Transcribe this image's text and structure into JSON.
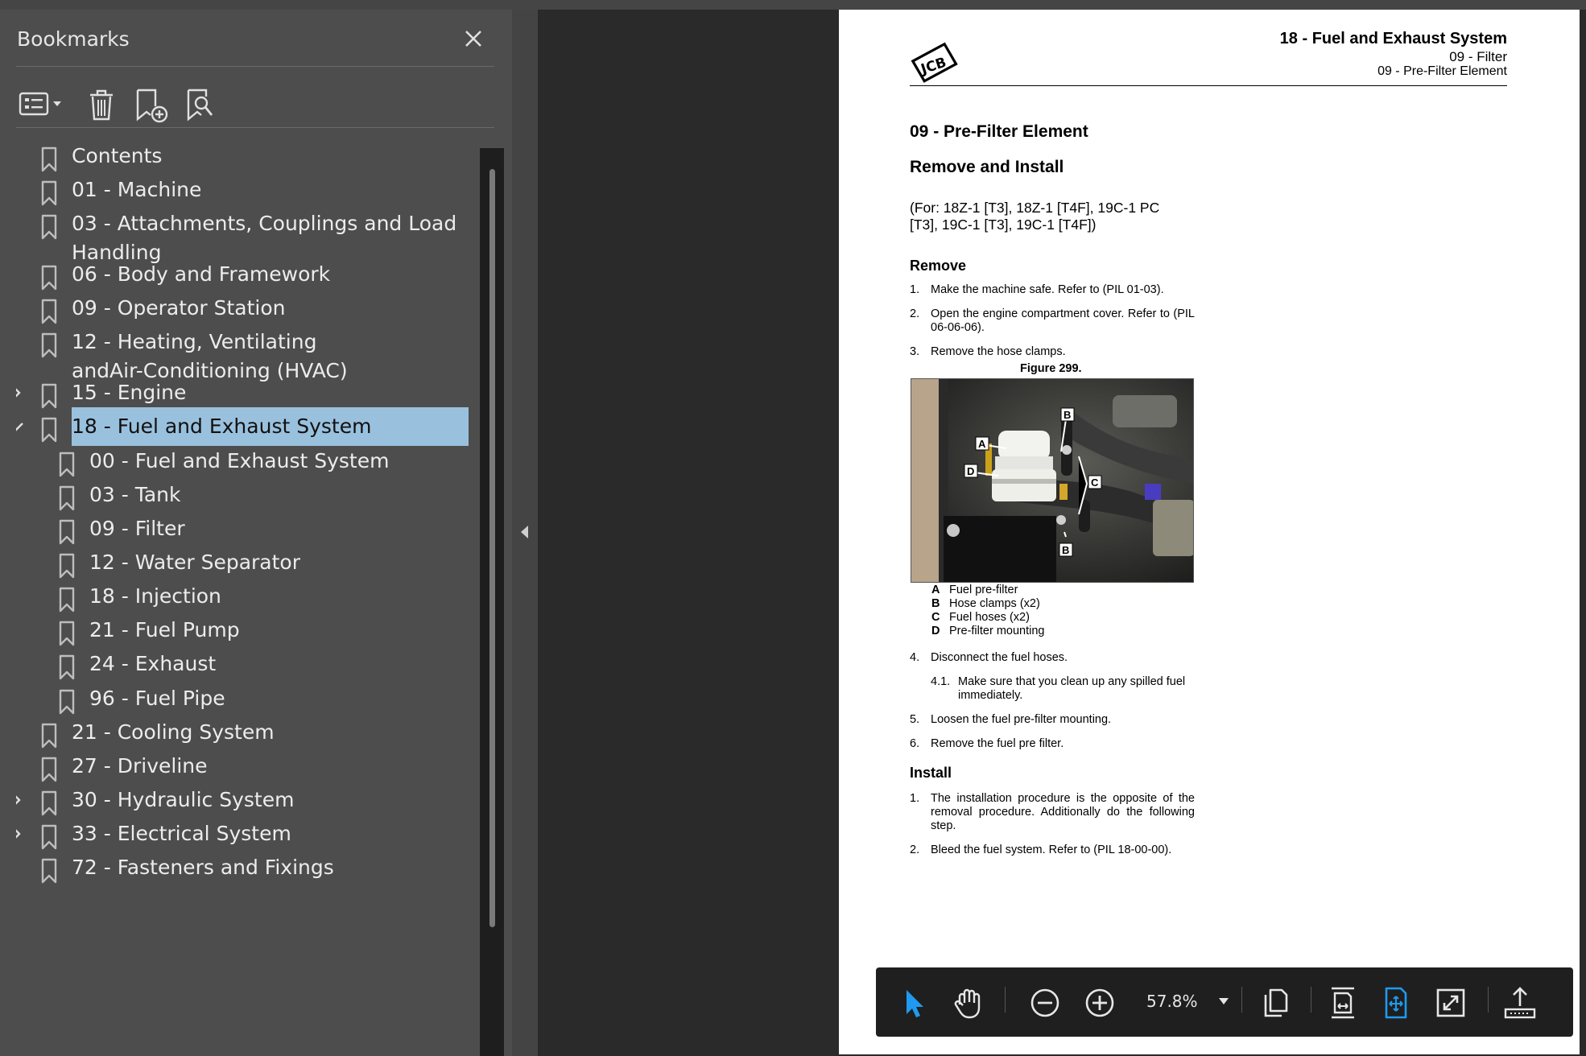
{
  "bookmarks_panel": {
    "title": "Bookmarks",
    "close_icon": "close-icon",
    "toolbar": [
      {
        "name": "bookmark-options-button",
        "icon": "list-options-icon"
      },
      {
        "name": "delete-bookmark-button",
        "icon": "trash-icon"
      },
      {
        "name": "add-bookmark-button",
        "icon": "bookmark-add-icon"
      },
      {
        "name": "find-bookmark-button",
        "icon": "bookmark-search-icon"
      }
    ],
    "items": [
      {
        "label": "Contents",
        "level": 0,
        "expander": "none"
      },
      {
        "label": "01 - Machine",
        "level": 0,
        "expander": "none"
      },
      {
        "label_line1": "03 - Attachments, Couplings and Load",
        "label_line2": "Handling",
        "level": 0,
        "expander": "none"
      },
      {
        "label": "06 - Body and Framework",
        "level": 0,
        "expander": "none"
      },
      {
        "label": "09 - Operator Station",
        "level": 0,
        "expander": "none"
      },
      {
        "label_line1": "12 - Heating, Ventilating",
        "label_line2": "andAir-Conditioning (HVAC)",
        "level": 0,
        "expander": "none"
      },
      {
        "label": "15 - Engine",
        "level": 0,
        "expander": "collapsed"
      },
      {
        "label": "18 - Fuel and Exhaust System",
        "level": 0,
        "expander": "expanded",
        "selected": true
      },
      {
        "label": "00 - Fuel and Exhaust System",
        "level": 1,
        "expander": "none"
      },
      {
        "label": "03 - Tank",
        "level": 1,
        "expander": "none"
      },
      {
        "label": "09 - Filter",
        "level": 1,
        "expander": "none"
      },
      {
        "label": "12 - Water Separator",
        "level": 1,
        "expander": "none"
      },
      {
        "label": "18 - Injection",
        "level": 1,
        "expander": "none"
      },
      {
        "label": "21 - Fuel Pump",
        "level": 1,
        "expander": "none"
      },
      {
        "label": "24 - Exhaust",
        "level": 1,
        "expander": "none"
      },
      {
        "label": "96 - Fuel Pipe",
        "level": 1,
        "expander": "none"
      },
      {
        "label": "21 - Cooling System",
        "level": 0,
        "expander": "none"
      },
      {
        "label": "27 - Driveline",
        "level": 0,
        "expander": "none"
      },
      {
        "label": "30 - Hydraulic System",
        "level": 0,
        "expander": "collapsed"
      },
      {
        "label": "33 - Electrical System",
        "level": 0,
        "expander": "collapsed"
      },
      {
        "label": "72 - Fasteners and Fixings",
        "level": 0,
        "expander": "none"
      }
    ]
  },
  "document": {
    "header_title": "18 - Fuel and Exhaust System",
    "header_sub1": "09 - Filter",
    "header_sub2": "09 - Pre-Filter Element",
    "heading1": "09 - Pre-Filter Element",
    "heading2": "Remove and Install",
    "applies_to_line1": "(For: 18Z-1 [T3], 18Z-1 [T4F], 19C-1 PC",
    "applies_to_line2": "[T3], 19C-1 [T3], 19C-1 [T4F])",
    "remove_heading": "Remove",
    "remove_steps": [
      {
        "n": "1.",
        "text": "Make the machine safe. Refer to (PIL 01-03)."
      },
      {
        "n": "2.",
        "text": "Open the engine compartment cover. Refer to (PIL 06-06-06)."
      },
      {
        "n": "3.",
        "text": "Remove the hose clamps."
      }
    ],
    "figure_title": "Figure 299.",
    "figure_callouts": [
      "A",
      "B",
      "B",
      "C",
      "D"
    ],
    "legend": [
      {
        "key": "A",
        "text": "Fuel pre-filter"
      },
      {
        "key": "B",
        "text": "Hose clamps (x2)"
      },
      {
        "key": "C",
        "text": "Fuel hoses (x2)"
      },
      {
        "key": "D",
        "text": "Pre-filter mounting"
      }
    ],
    "remove_steps_2": [
      {
        "n": "4.",
        "text": "Disconnect the fuel hoses."
      },
      {
        "n": "4.1.",
        "text": "Make sure that you clean up any spilled fuel immediately."
      },
      {
        "n": "5.",
        "text": "Loosen the fuel pre-filter mounting."
      },
      {
        "n": "6.",
        "text": "Remove the fuel pre filter."
      }
    ],
    "install_heading": "Install",
    "install_steps": [
      {
        "n": "1.",
        "text": "The installation procedure is the opposite of the removal procedure. Additionally do the following step."
      },
      {
        "n": "2.",
        "text": "Bleed the fuel system. Refer to (PIL 18-00-00)."
      }
    ]
  },
  "floating_toolbar": {
    "zoom": "57.8%",
    "buttons": [
      "select-arrow-icon",
      "hand-icon",
      "zoom-out-icon",
      "zoom-in-icon",
      "zoom-dropdown-icon",
      "page-view-icon",
      "fit-width-icon",
      "fit-page-icon",
      "fullscreen-icon",
      "export-icon"
    ],
    "active_color": "#1e9bf0"
  }
}
